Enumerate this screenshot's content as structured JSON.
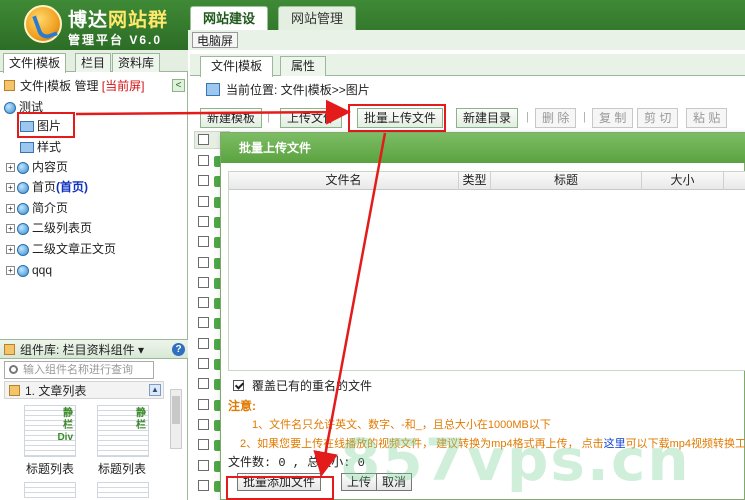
{
  "header": {
    "logo_main": "博达",
    "logo_accent": "网站群",
    "subtitle": "管理平台  V6.0",
    "tabs": [
      {
        "label": "网站建设",
        "active": true
      },
      {
        "label": "网站管理",
        "active": false
      }
    ],
    "sub_button": "电脑屏"
  },
  "left": {
    "tabs": [
      "文件|模板",
      "栏目",
      "资料库"
    ],
    "panel_title": "文件|模板 管理",
    "current_screen": "[当前屏]",
    "collapse_icon": "<",
    "tree": [
      {
        "label": "测试",
        "icon": "globe-icon",
        "expander": ""
      },
      {
        "label": "图片",
        "icon": "image-folder-icon",
        "selected": true
      },
      {
        "label": "样式",
        "icon": "image-folder-icon"
      },
      {
        "label": "内容页",
        "icon": "globe-icon",
        "expander": "+"
      },
      {
        "label": "首页",
        "suffix": "(首页)",
        "icon": "globe-icon",
        "expander": "+"
      },
      {
        "label": "简介页",
        "icon": "globe-icon",
        "expander": "+"
      },
      {
        "label": "二级列表页",
        "icon": "globe-icon",
        "expander": "+"
      },
      {
        "label": "二级文章正文页",
        "icon": "globe-icon",
        "expander": "+"
      },
      {
        "label": "qqq",
        "icon": "globe-icon",
        "expander": "+"
      }
    ],
    "component_header": "组件库: 栏目资料组件 ▾",
    "help_icon": "?",
    "search_placeholder": "输入组件名称进行查询",
    "section": "1. 文章列表",
    "widgets": [
      {
        "tag": "静\n栏\nDiv",
        "label": "标题列表"
      },
      {
        "tag": "静\n栏",
        "label": "标题列表"
      }
    ]
  },
  "right": {
    "tabs": [
      {
        "label": "文件|模板",
        "active": true
      },
      {
        "label": "属性",
        "active": false
      }
    ],
    "location": "当前位置: 文件|模板>>图片",
    "toolbar": {
      "new_template": "新建模板",
      "upload_file": "上传文件",
      "batch_upload": "批量上传文件",
      "new_dir": "新建目录",
      "delete": "删 除",
      "copy": "复 制",
      "cut": "剪 切",
      "paste": "粘 贴",
      "separator": "|"
    }
  },
  "dialog": {
    "title": "批量上传文件",
    "columns": [
      "文件名",
      "类型",
      "标题",
      "大小"
    ],
    "overwrite_label": "覆盖已有的重名的文件",
    "overwrite_checked": true,
    "note_title": "注意:",
    "note1": "1、文件名只允许英文、数字、-和_，且总大小在1000MB以下",
    "note2_a": "2、如果您要上传在线播放的视频文件， 建议转换为mp4格式再上传， 点击",
    "note2_link": "这里",
    "note2_b": "可以下载mp4视频转换工",
    "count_text": "文件数: 0 , 总大小: 0",
    "buttons": {
      "batch_add": "批量添加文件",
      "upload": "上传",
      "cancel": "取消"
    }
  },
  "watermark": "857vps.cn",
  "colors": {
    "header_green": "#2c6d26",
    "dialog_title": "#5aa240",
    "highlight_red": "#e41b1b",
    "note_orange": "#e07a00"
  }
}
